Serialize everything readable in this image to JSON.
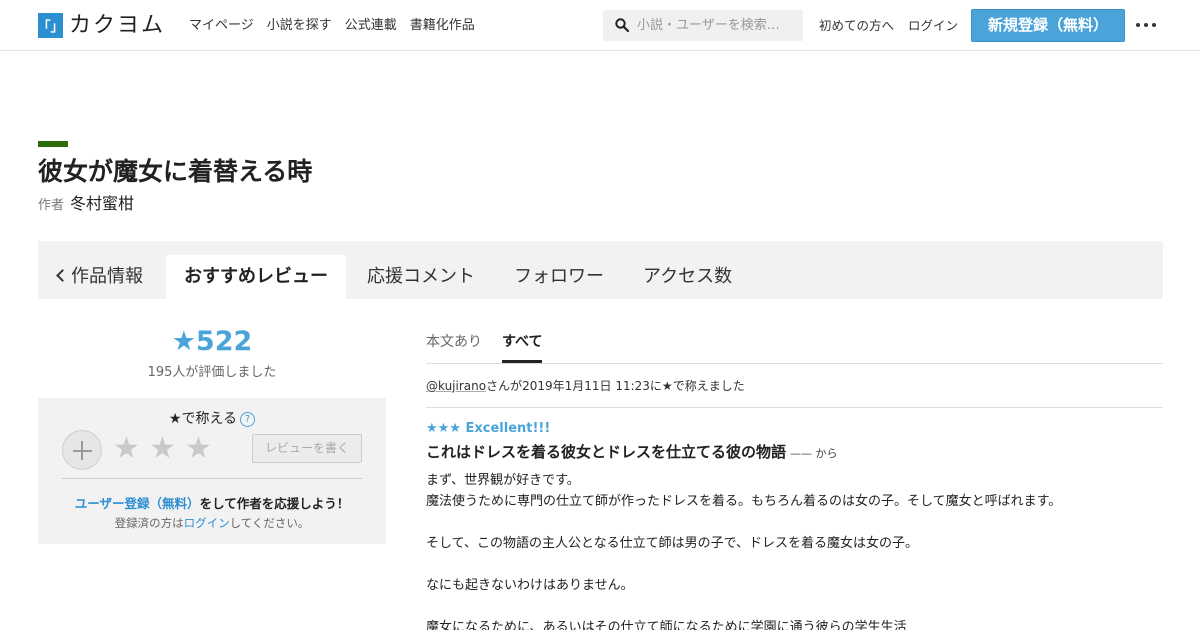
{
  "header": {
    "logo_mark": "「」",
    "logo_text": "カクヨム",
    "nav": [
      "マイページ",
      "小説を探す",
      "公式連載",
      "書籍化作品"
    ],
    "search_placeholder": "小説・ユーザーを検索…",
    "first_time": "初めての方へ",
    "login": "ログイン",
    "register": "新規登録（無料）"
  },
  "work": {
    "title": "彼女が魔女に着替える時",
    "author_label": "作者",
    "author": "冬村蜜柑"
  },
  "tabs": {
    "back": "作品情報",
    "items": [
      "おすすめレビュー",
      "応援コメント",
      "フォロワー",
      "アクセス数"
    ],
    "active": "おすすめレビュー"
  },
  "rating": {
    "score": "★522",
    "count_text": "195人が評価しました",
    "praise_title": "★で称える",
    "help": "?",
    "write_review": "レビューを書く",
    "cta_link": "ユーザー登録（無料）",
    "cta_rest": "をして作者を応援しよう！",
    "login_pre": "登録済の方は",
    "login_link": "ログイン",
    "login_post": "してください。"
  },
  "review_filters": [
    "本文あり",
    "すべて"
  ],
  "review": {
    "user": "@kujirano",
    "meta": "さんが2019年1月11日 11:23に★で称えました",
    "stars": "★★★ Excellent!!!",
    "title": "これはドレスを着る彼女とドレスを仕立てる彼の物語",
    "from": "—— から",
    "body": [
      "まず、世界観が好きです。",
      "魔法使うために専門の仕立て師が作ったドレスを着る。もちろん着るのは女の子。そして魔女と呼ばれます。",
      "",
      "そして、この物語の主人公となる仕立て師は男の子で、ドレスを着る魔女は女の子。",
      "",
      "なにも起きないわけはありません。",
      "",
      "魔女になるために、あるいはその仕立て師になるために学園に通う彼らの学生生活"
    ]
  },
  "colors": {
    "brand_blue": "#2c8fd1",
    "accent_blue": "#4aa4d9",
    "title_accent": "#2e6b0a"
  }
}
